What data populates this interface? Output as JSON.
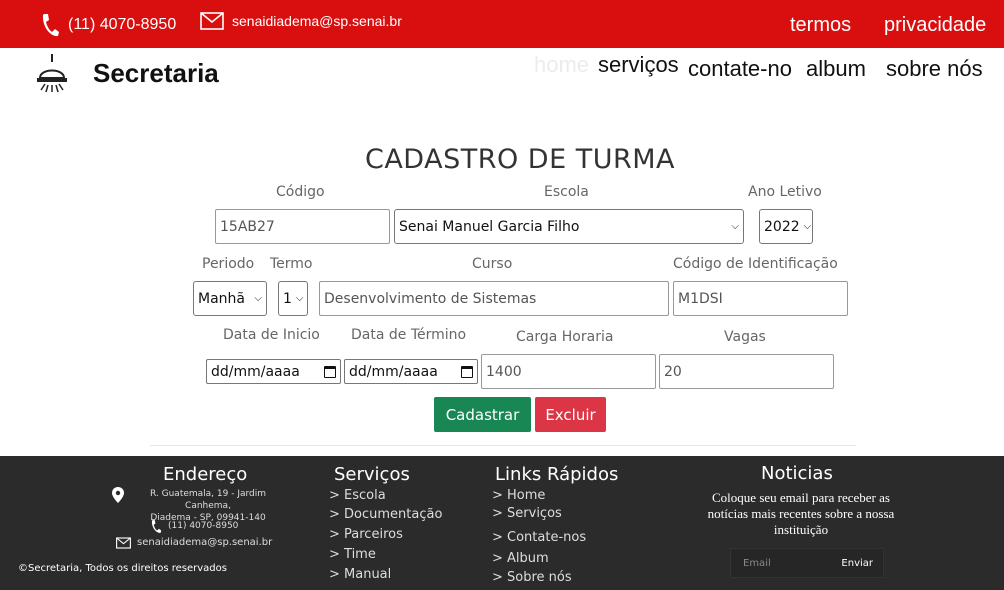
{
  "topbar": {
    "phone": "(11) 4070-8950",
    "email": "senaidiadema@sp.senai.br",
    "links": [
      "termos",
      "privacidade"
    ]
  },
  "header": {
    "brand": "Secretaria",
    "nav": [
      "home",
      "serviços",
      "contate-no",
      "album",
      "sobre nós"
    ]
  },
  "form": {
    "title": "CADASTRO DE TURMA",
    "labels": {
      "codigo": "Código",
      "escola": "Escola",
      "ano": "Ano Letivo",
      "periodo": "Periodo",
      "termo": "Termo",
      "curso": "Curso",
      "codigo_id": "Código de Identificação",
      "data_inicio": "Data de Inicio",
      "data_termino": "Data de Término",
      "carga": "Carga Horaria",
      "vagas": "Vagas"
    },
    "values": {
      "codigo": "15AB27",
      "escola": "Senai Manuel Garcia Filho",
      "ano": "2022",
      "periodo": "Manhã",
      "termo": "1",
      "curso": "Desenvolvimento de Sistemas",
      "codigo_id": "M1DSI",
      "data_inicio": "dd/mm/aaaa",
      "data_termino": "dd/mm/aaaa",
      "carga": "1400",
      "vagas": "20"
    },
    "buttons": {
      "cadastrar": "Cadastrar",
      "excluir": "Excluir"
    }
  },
  "footer": {
    "endereco": {
      "title": "Endereço",
      "address_line1": "R. Guatemala, 19 - Jardim Canhema,",
      "address_line2": "Diadema - SP, 09941-140",
      "phone": "(11) 4070-8950",
      "email": "senaidiadema@sp.senai.br"
    },
    "servicos": {
      "title": "Serviços",
      "items": [
        "> Escola",
        "> Documentação",
        "> Parceiros",
        "> Time",
        "> Manual"
      ]
    },
    "links": {
      "title": "Links Rápidos",
      "items": [
        "> Home",
        "> Serviços",
        "> Contate-nos",
        "> Album",
        "> Sobre nós"
      ]
    },
    "noticias": {
      "title": "Noticias",
      "text": "Coloque seu email para receber as notícias mais recentes sobre a nossa instituição",
      "email_placeholder": "Email",
      "send_label": "Enviar"
    },
    "copyright": "©Secretaria, Todos os direitos reservados"
  },
  "colors": {
    "topbar": "#d90f0f",
    "footer": "#2b2b2b",
    "btn_primary": "#198754",
    "btn_danger": "#dc3545"
  }
}
